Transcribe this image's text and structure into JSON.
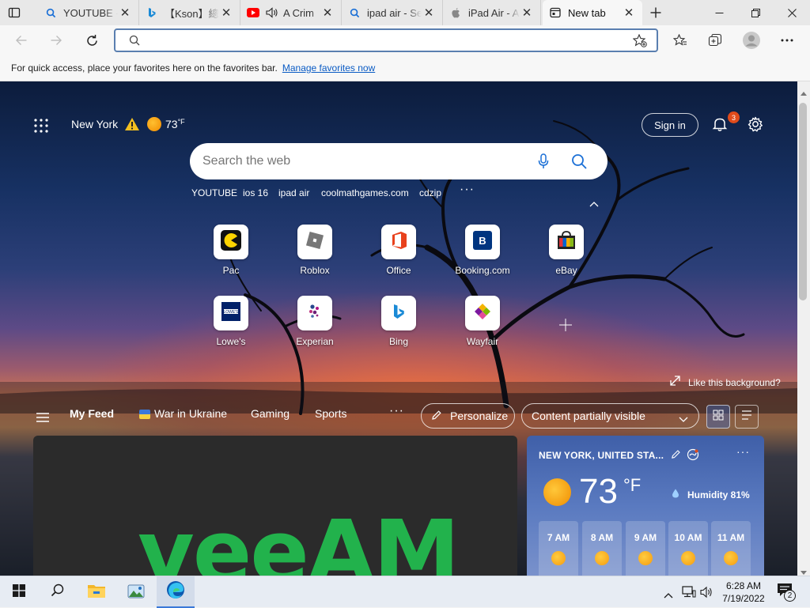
{
  "tabs": [
    {
      "label": "YOUTUBE -",
      "icon": "search-icon"
    },
    {
      "label": "【Kson】總長",
      "icon": "bing-icon"
    },
    {
      "label": "A Crim",
      "icon": "youtube-icon"
    },
    {
      "label": "ipad air - Se",
      "icon": "search-icon"
    },
    {
      "label": "iPad Air - A",
      "icon": "apple-icon"
    },
    {
      "label": "New tab",
      "icon": "newtab-icon",
      "active": true
    }
  ],
  "favorites_bar": {
    "message": "For quick access, place your favorites here on the favorites bar.",
    "link": "Manage favorites now"
  },
  "header": {
    "location": "New York",
    "temperature": "73",
    "unit": "°F",
    "sign_in": "Sign in",
    "notification_count": "3"
  },
  "search": {
    "placeholder": "Search the web"
  },
  "quick_links": [
    "YOUTUBE",
    "ios 16",
    "ipad air",
    "coolmathgames.com",
    "cdzip"
  ],
  "top_sites": [
    {
      "label": "Pac",
      "icon": "pacman-icon"
    },
    {
      "label": "Roblox",
      "icon": "roblox-icon"
    },
    {
      "label": "Office",
      "icon": "office-icon"
    },
    {
      "label": "Booking.com",
      "icon": "booking-icon"
    },
    {
      "label": "eBay",
      "icon": "ebay-icon"
    },
    {
      "label": "Lowe's",
      "icon": "lowes-icon"
    },
    {
      "label": "Experian",
      "icon": "experian-icon"
    },
    {
      "label": "Bing",
      "icon": "bing-icon"
    },
    {
      "label": "Wayfair",
      "icon": "wayfair-icon"
    }
  ],
  "background": {
    "like_label": "Like this background?"
  },
  "feed": {
    "my_feed": "My Feed",
    "items": [
      "War in Ukraine",
      "Gaming",
      "Sports"
    ],
    "personalize": "Personalize",
    "visibility": "Content partially visible",
    "card_brand": "veeAM"
  },
  "weather": {
    "location": "NEW YORK, UNITED STA...",
    "temp": "73",
    "unit": "°F",
    "humidity": "Humidity 81%",
    "hours": [
      "7 AM",
      "8 AM",
      "9 AM",
      "10 AM",
      "11 AM"
    ]
  },
  "taskbar": {
    "time": "6:28 AM",
    "date": "7/19/2022",
    "notifications": "2"
  },
  "colors": {
    "accent": "#0a5bc4",
    "youtube": "#ff0000",
    "weather_card": "#4a68b0",
    "badge": "#e04b1b"
  }
}
